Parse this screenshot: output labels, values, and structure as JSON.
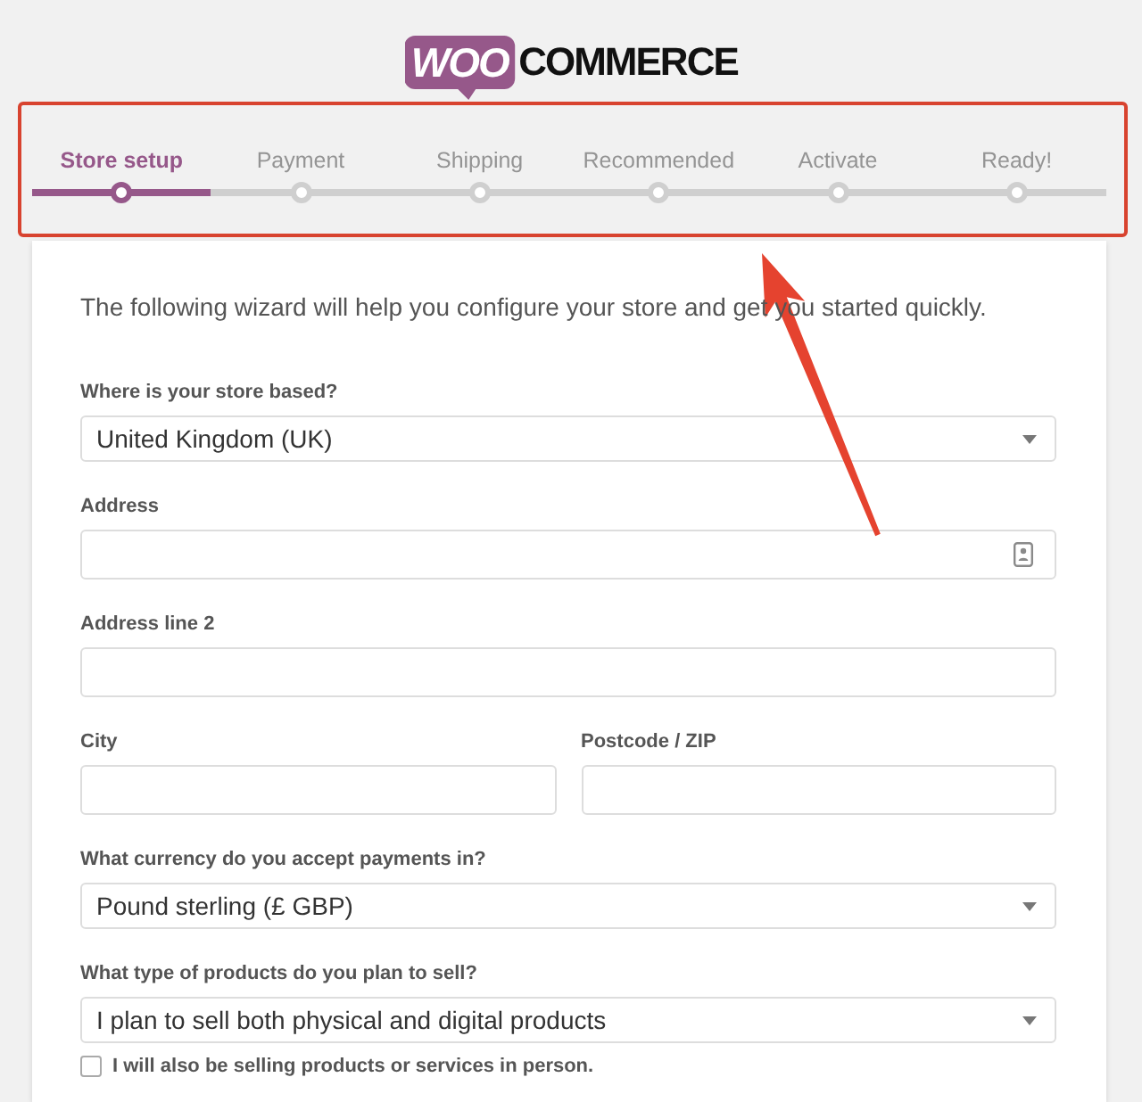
{
  "logo": {
    "badge": "WOO",
    "wordmark": "COMMERCE"
  },
  "steps": [
    {
      "label": "Store setup",
      "selected": true
    },
    {
      "label": "Payment",
      "selected": false
    },
    {
      "label": "Shipping",
      "selected": false
    },
    {
      "label": "Recommended",
      "selected": false
    },
    {
      "label": "Activate",
      "selected": false
    },
    {
      "label": "Ready!",
      "selected": false
    }
  ],
  "intro": "The following wizard will help you configure your store and get you started quickly.",
  "rows": [
    {
      "fields": [
        {
          "kind": "select",
          "label": "Where is your store based?",
          "value": "United Kingdom (UK)"
        }
      ]
    },
    {
      "fields": [
        {
          "kind": "text",
          "label": "Address",
          "autofill": true
        }
      ]
    },
    {
      "fields": [
        {
          "kind": "text",
          "label": "Address line 2",
          "autofill": false
        }
      ]
    },
    {
      "fields": [
        {
          "kind": "text",
          "label": "City",
          "autofill": false
        },
        {
          "kind": "text",
          "label": "Postcode / ZIP",
          "autofill": false
        }
      ]
    },
    {
      "fields": [
        {
          "kind": "select",
          "label": "What currency do you accept payments in?",
          "value": "Pound sterling (£ GBP)"
        }
      ]
    },
    {
      "fields": [
        {
          "kind": "select",
          "label": "What type of products do you plan to sell?",
          "value": "I plan to sell both physical and digital products"
        }
      ]
    }
  ],
  "checkbox": {
    "label": "I will also be selling products or services in person.",
    "checked": false
  },
  "annotation": {
    "box_around_steps": true,
    "arrow_to_steps": true
  }
}
